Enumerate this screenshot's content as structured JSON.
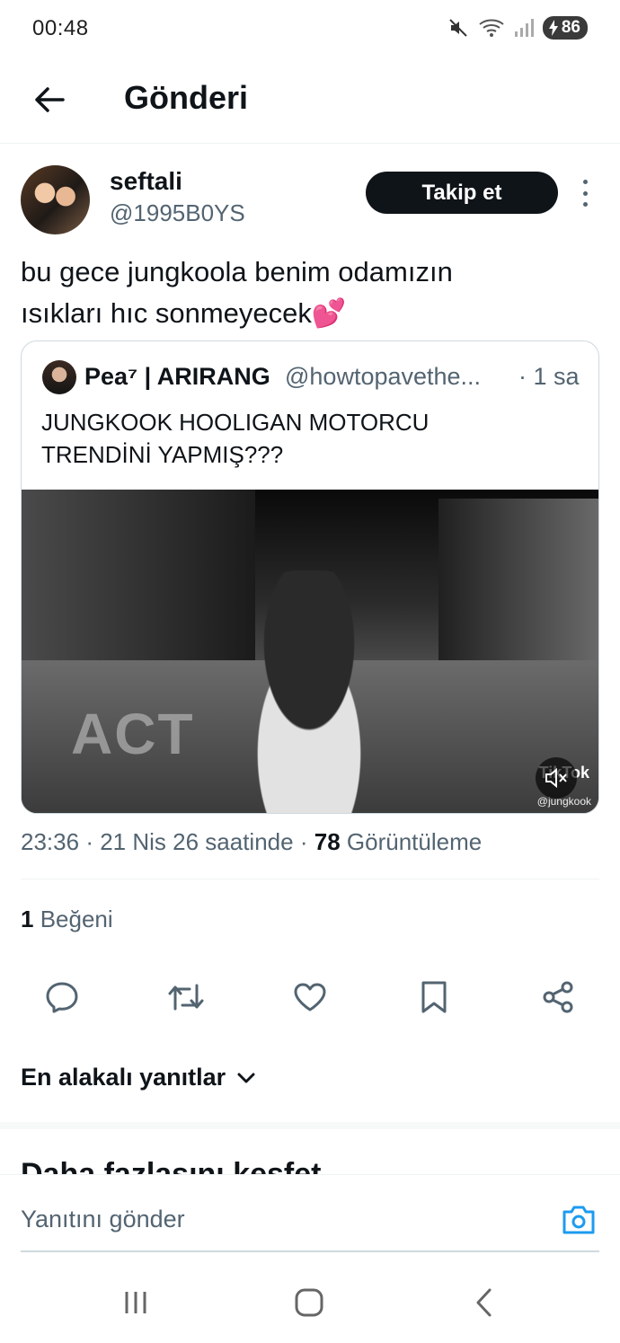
{
  "status_bar": {
    "time": "00:48",
    "battery": "86",
    "icons": [
      "mute-icon",
      "wifi-icon",
      "signal-icon",
      "battery-icon"
    ]
  },
  "header": {
    "title": "Gönderi",
    "back_icon": "arrow-left-icon"
  },
  "tweet": {
    "display_name": "seftali",
    "handle": "@1995B0YS",
    "follow_label": "Takip et",
    "text_lines": [
      "bu gece jungkoola benim odamızın",
      "ısıkları hıc sonmeyecek💕"
    ],
    "quote": {
      "name": "Pea⁷ | ARIRANG",
      "handle": "@howtopavethe...",
      "time": "· 1 sa",
      "text_lines": [
        "JUNGKOOK HOOLIGAN MOTORCU",
        "TRENDİNİ YAPMIŞ???"
      ],
      "media": {
        "overlay_text": "ACT",
        "watermark": "TikTok",
        "watermark_handle": "@jungkook"
      }
    },
    "meta": {
      "time": "23:36",
      "date": "21 Nis 26 saatinde",
      "views_count": "78",
      "views_label": "Görüntüleme",
      "separator": "·"
    },
    "likes": {
      "count": "1",
      "label": "Beğeni"
    }
  },
  "actions": [
    "reply-icon",
    "retweet-icon",
    "like-icon",
    "bookmark-icon",
    "share-icon"
  ],
  "replies": {
    "sort_label": "En alakalı yanıtlar"
  },
  "explore": {
    "title": "Daha fazlasını keşfet"
  },
  "reply_bar": {
    "placeholder": "Yanıtını gönder"
  },
  "colors": {
    "text_primary": "#0f1419",
    "text_secondary": "#536471",
    "accent": "#1d9bf0",
    "border": "#cfd9de"
  }
}
